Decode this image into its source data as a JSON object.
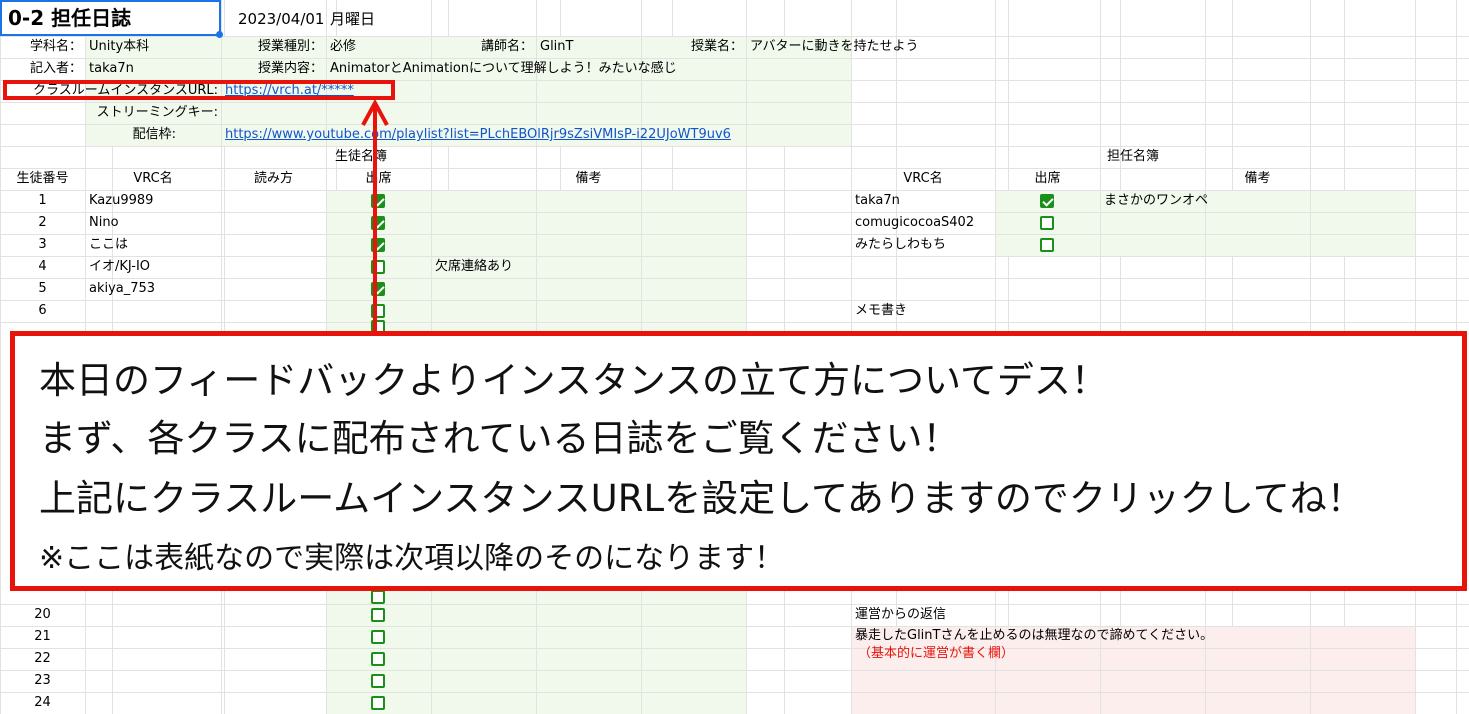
{
  "header": {
    "title": "0-2 担任日誌",
    "date": "2023/04/01",
    "weekday": "月曜日"
  },
  "info": {
    "department_label": "学科名：",
    "department": "Unity本科",
    "class_type_label": "授業種別：",
    "class_type": "必修",
    "instructor_label": "講師名：",
    "instructor": "GlinT",
    "class_name_label": "授業名：",
    "class_name": "アバターに動きを持たせよう",
    "recorder_label": "記入者：",
    "recorder": "taka7n",
    "content_label": "授業内容：",
    "content": "AnimatorとAnimationについて理解しよう！みたいな感じ",
    "instance_label": "クラスルームインスタンスURL:",
    "instance_url": "https://vrch.at/*****",
    "stream_key_label": "ストリーミングキー:",
    "stream_label": "配信枠:",
    "stream_url": "https://www.youtube.com/playlist?list=PLchEBOlRjr9sZsiVMIsP-i22UJoWT9uv6"
  },
  "students": {
    "section_title": "生徒名簿",
    "headers": [
      "生徒番号",
      "VRC名",
      "読み方",
      "出席",
      "備考"
    ],
    "rows": [
      {
        "no": "1",
        "name": "Kazu9989",
        "reading": "",
        "present": true,
        "note": ""
      },
      {
        "no": "2",
        "name": "Nino",
        "reading": "",
        "present": true,
        "note": ""
      },
      {
        "no": "3",
        "name": "ここは",
        "reading": "",
        "present": true,
        "note": ""
      },
      {
        "no": "4",
        "name": "イオ/KJ-IO",
        "reading": "",
        "present": false,
        "note": "欠席連絡あり"
      },
      {
        "no": "5",
        "name": "akiya_753",
        "reading": "",
        "present": true,
        "note": ""
      },
      {
        "no": "6",
        "name": "",
        "reading": "",
        "present": false,
        "note": ""
      },
      {
        "no": "20",
        "name": "",
        "reading": "",
        "present": false,
        "note": ""
      },
      {
        "no": "21",
        "name": "",
        "reading": "",
        "present": false,
        "note": ""
      },
      {
        "no": "22",
        "name": "",
        "reading": "",
        "present": false,
        "note": ""
      },
      {
        "no": "23",
        "name": "",
        "reading": "",
        "present": false,
        "note": ""
      },
      {
        "no": "24",
        "name": "",
        "reading": "",
        "present": false,
        "note": ""
      }
    ]
  },
  "teachers": {
    "section_title": "担任名簿",
    "headers": [
      "VRC名",
      "出席",
      "備考"
    ],
    "rows": [
      {
        "name": "taka7n",
        "present": true,
        "note": "まさかのワンオペ"
      },
      {
        "name": "comugicocoaS402",
        "present": false,
        "note": ""
      },
      {
        "name": "みたらしわもち",
        "present": false,
        "note": ""
      }
    ]
  },
  "memo": {
    "label": "メモ書き"
  },
  "reply": {
    "label": "運営からの返信",
    "text": "暴走したGlinTさんを止めるのは無理なので諦めてください。",
    "hint": "（基本的に運営が書く欄）"
  },
  "callout": {
    "lines": [
      "本日のフィードバックよりインスタンスの立て方についてデス！",
      "まず、各クラスに配布されている日誌をご覧ください！",
      "上記にクラスルームインスタンスURLを設定してありますのでクリックしてね！",
      "※ここは表紙なので実際は次項以降のそのになります！"
    ]
  },
  "colors": {
    "accent_red": "#e8140c",
    "check_green": "#1a8f1a",
    "link_blue": "#1155cc",
    "selection_blue": "#1a73e8"
  }
}
